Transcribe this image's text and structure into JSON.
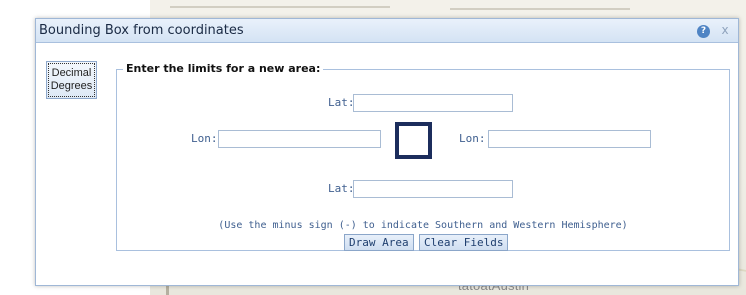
{
  "background": {
    "map_label": "tatoatAustin"
  },
  "dialog": {
    "title": "Bounding Box from coordinates",
    "help_icon": "help-icon",
    "help_glyph": "?",
    "close_icon": "close-icon",
    "close_glyph": "x",
    "mode_tab": {
      "line1": "Decimal",
      "line2": "Degrees"
    },
    "form": {
      "legend": "Enter the limits for a new area:",
      "north": {
        "label": "Lat:",
        "value": ""
      },
      "west": {
        "label": "Lon:",
        "value": ""
      },
      "east": {
        "label": "Lon:",
        "value": ""
      },
      "south": {
        "label": "Lat:",
        "value": ""
      },
      "hint": "(Use the minus sign (-) to indicate Southern and Western Hemisphere)",
      "draw_button": "Draw Area",
      "clear_button": "Clear Fields"
    }
  },
  "colors": {
    "title_text": "#1a2a44",
    "label_blue": "#3f5f8f",
    "square_border": "#1c2d5c",
    "panel_border": "#a9c0de"
  }
}
